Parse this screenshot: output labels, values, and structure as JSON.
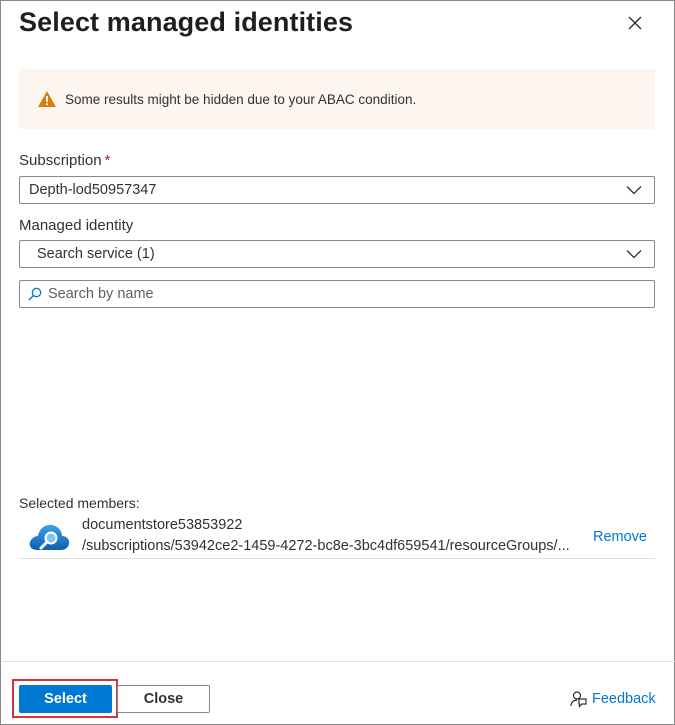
{
  "panel": {
    "title": "Select managed identities"
  },
  "warning": {
    "text": "Some results might be hidden due to your ABAC condition."
  },
  "subscription": {
    "label": "Subscription",
    "required_marker": "*",
    "value": "Depth-lod50957347"
  },
  "managed_identity": {
    "label": "Managed identity",
    "value": "Search service (1)"
  },
  "search": {
    "placeholder": "Search by name",
    "value": ""
  },
  "selected": {
    "label": "Selected members:",
    "members": [
      {
        "name": "documentstore53853922",
        "path": "/subscriptions/53942ce2-1459-4272-bc8e-3bc4df659541/resourceGroups/...",
        "action": "Remove",
        "icon": "search-service-cloud-icon"
      }
    ]
  },
  "footer": {
    "select_label": "Select",
    "close_label": "Close",
    "feedback_label": "Feedback"
  },
  "colors": {
    "accent": "#0078d4",
    "warning_bg": "#fdf6f0",
    "warning_icon": "#d67f0b",
    "required": "#a4262c",
    "highlight": "#d13438"
  }
}
